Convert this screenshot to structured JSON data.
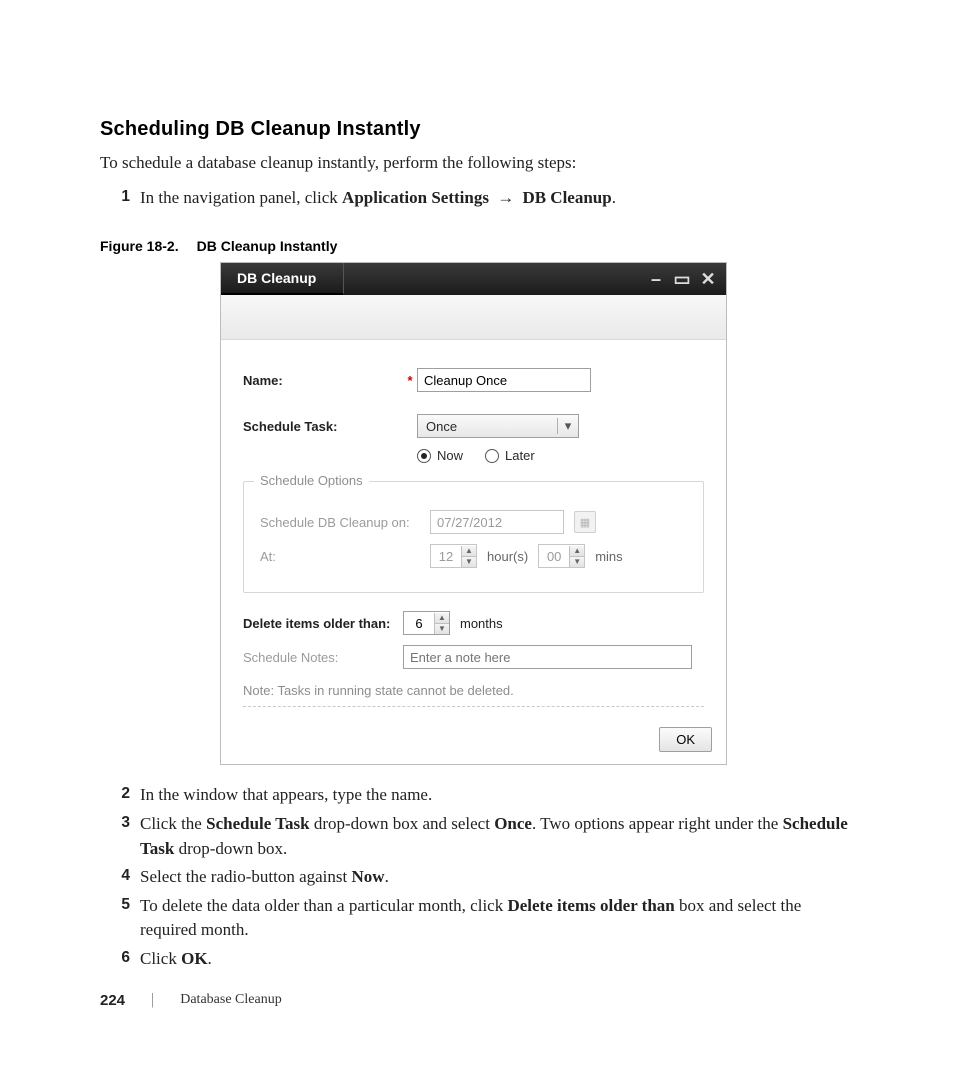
{
  "heading": "Scheduling DB Cleanup Instantly",
  "intro": "To schedule a database cleanup instantly, perform the following steps:",
  "step1": {
    "num": "1",
    "pre": "In the navigation panel, click ",
    "b1": "Application Settings",
    "arrow": "→",
    "b2": "DB Cleanup",
    "post": "."
  },
  "figcap_a": "Figure 18-2.",
  "figcap_b": "DB Cleanup Instantly",
  "dialog": {
    "title": "DB Cleanup",
    "labels": {
      "name": "Name:",
      "schedule_task": "Schedule Task:",
      "schedule_options": "Schedule Options",
      "cleanup_on": "Schedule DB Cleanup on:",
      "at": "At:",
      "delete_older": "Delete items older than:",
      "schedule_notes": "Schedule Notes:"
    },
    "required_mark": "*",
    "name_value": "Cleanup Once",
    "task_value": "Once",
    "radio_now": "Now",
    "radio_later": "Later",
    "date_value": "07/27/2012",
    "hours_value": "12",
    "hours_unit": "hour(s)",
    "mins_value": "00",
    "mins_unit": "mins",
    "months_value": "6",
    "months_unit": "months",
    "notes_placeholder": "Enter a note here",
    "footer_note": "Note: Tasks in running state cannot be deleted.",
    "ok": "OK"
  },
  "step2": {
    "num": "2",
    "txt": "In the window that appears, type the name."
  },
  "step3": {
    "num": "3",
    "a": "Click the ",
    "b1": "Schedule Task",
    "c": " drop-down box and select ",
    "b2": "Once",
    "d": ". Two options appear right under the ",
    "b3": "Schedule Task",
    "e": " drop-down box."
  },
  "step4": {
    "num": "4",
    "a": "Select the radio-button against ",
    "b1": "Now",
    "c": "."
  },
  "step5": {
    "num": "5",
    "a": "To delete the data older than a particular month, click ",
    "b1": "Delete items older than",
    "c": " box and select the required month."
  },
  "step6": {
    "num": "6",
    "a": "Click ",
    "b1": "OK",
    "c": "."
  },
  "footer": {
    "page": "224",
    "pipe": "|",
    "section": "Database Cleanup"
  }
}
